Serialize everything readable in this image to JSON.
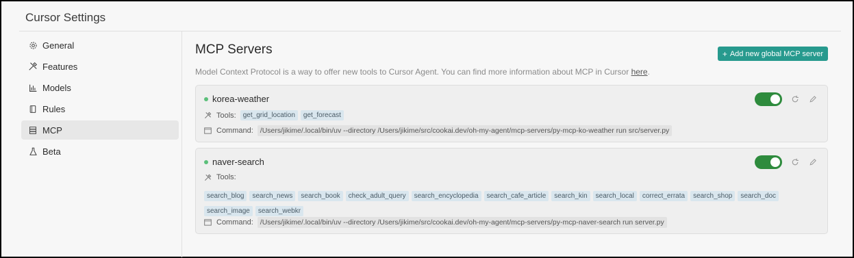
{
  "window": {
    "title": "Cursor Settings"
  },
  "sidebar": {
    "items": [
      {
        "label": "General",
        "icon": "gear-icon",
        "active": false
      },
      {
        "label": "Features",
        "icon": "tools-icon",
        "active": false
      },
      {
        "label": "Models",
        "icon": "chart-icon",
        "active": false
      },
      {
        "label": "Rules",
        "icon": "book-icon",
        "active": false
      },
      {
        "label": "MCP",
        "icon": "server-icon",
        "active": true
      },
      {
        "label": "Beta",
        "icon": "flask-icon",
        "active": false
      }
    ]
  },
  "main": {
    "title": "MCP Servers",
    "add_button": "Add new global MCP server",
    "description": "Model Context Protocol is a way to offer new tools to Cursor Agent. You can find more information about MCP in Cursor ",
    "description_link": "here",
    "description_end": "."
  },
  "servers": [
    {
      "name": "korea-weather",
      "enabled": true,
      "tools_label": "Tools:",
      "tools": [
        "get_grid_location",
        "get_forecast"
      ],
      "command_label": "Command:",
      "command": "/Users/jikime/.local/bin/uv --directory /Users/jikime/src/cookai.dev/oh-my-agent/mcp-servers/py-mcp-ko-weather run src/server.py"
    },
    {
      "name": "naver-search",
      "enabled": true,
      "tools_label": "Tools:",
      "tools": [
        "search_blog",
        "search_news",
        "search_book",
        "check_adult_query",
        "search_encyclopedia",
        "search_cafe_article",
        "search_kin",
        "search_local",
        "correct_errata",
        "search_shop",
        "search_doc",
        "search_image",
        "search_webkr"
      ],
      "command_label": "Command:",
      "command": "/Users/jikime/.local/bin/uv --directory /Users/jikime/src/cookai.dev/oh-my-agent/mcp-servers/py-mcp-naver-search run server.py"
    }
  ],
  "colors": {
    "accent": "#279a8e",
    "toggle_on": "#2e8b3d",
    "status_dot": "#5bbf7a",
    "tag_bg": "#d9e6ee"
  }
}
